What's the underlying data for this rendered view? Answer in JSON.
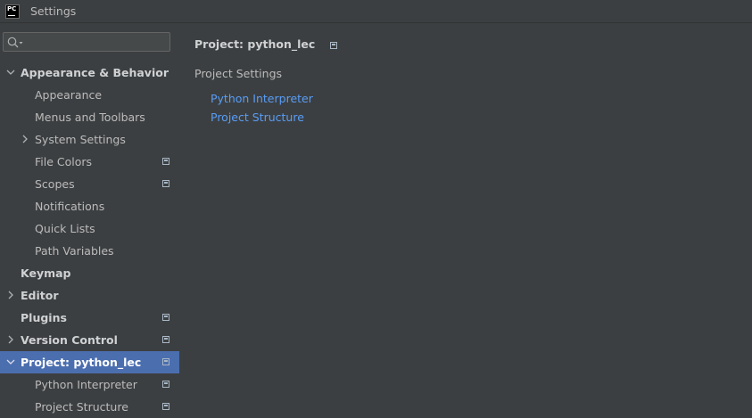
{
  "window": {
    "title": "Settings",
    "logo_text": "PC"
  },
  "search": {
    "placeholder": ""
  },
  "tree": {
    "appearance_behavior": "Appearance & Behavior",
    "appearance": "Appearance",
    "menus_toolbars": "Menus and Toolbars",
    "system_settings": "System Settings",
    "file_colors": "File Colors",
    "scopes": "Scopes",
    "notifications": "Notifications",
    "quick_lists": "Quick Lists",
    "path_variables": "Path Variables",
    "keymap": "Keymap",
    "editor": "Editor",
    "plugins": "Plugins",
    "version_control": "Version Control",
    "project": "Project: python_lec",
    "python_interpreter": "Python Interpreter",
    "project_structure": "Project Structure"
  },
  "main": {
    "header": "Project: python_lec",
    "section_title": "Project Settings",
    "links": [
      "Python Interpreter",
      "Project Structure"
    ]
  },
  "colors": {
    "background": "#3c3f41",
    "selection": "#4b6eaf",
    "link": "#589df6"
  }
}
